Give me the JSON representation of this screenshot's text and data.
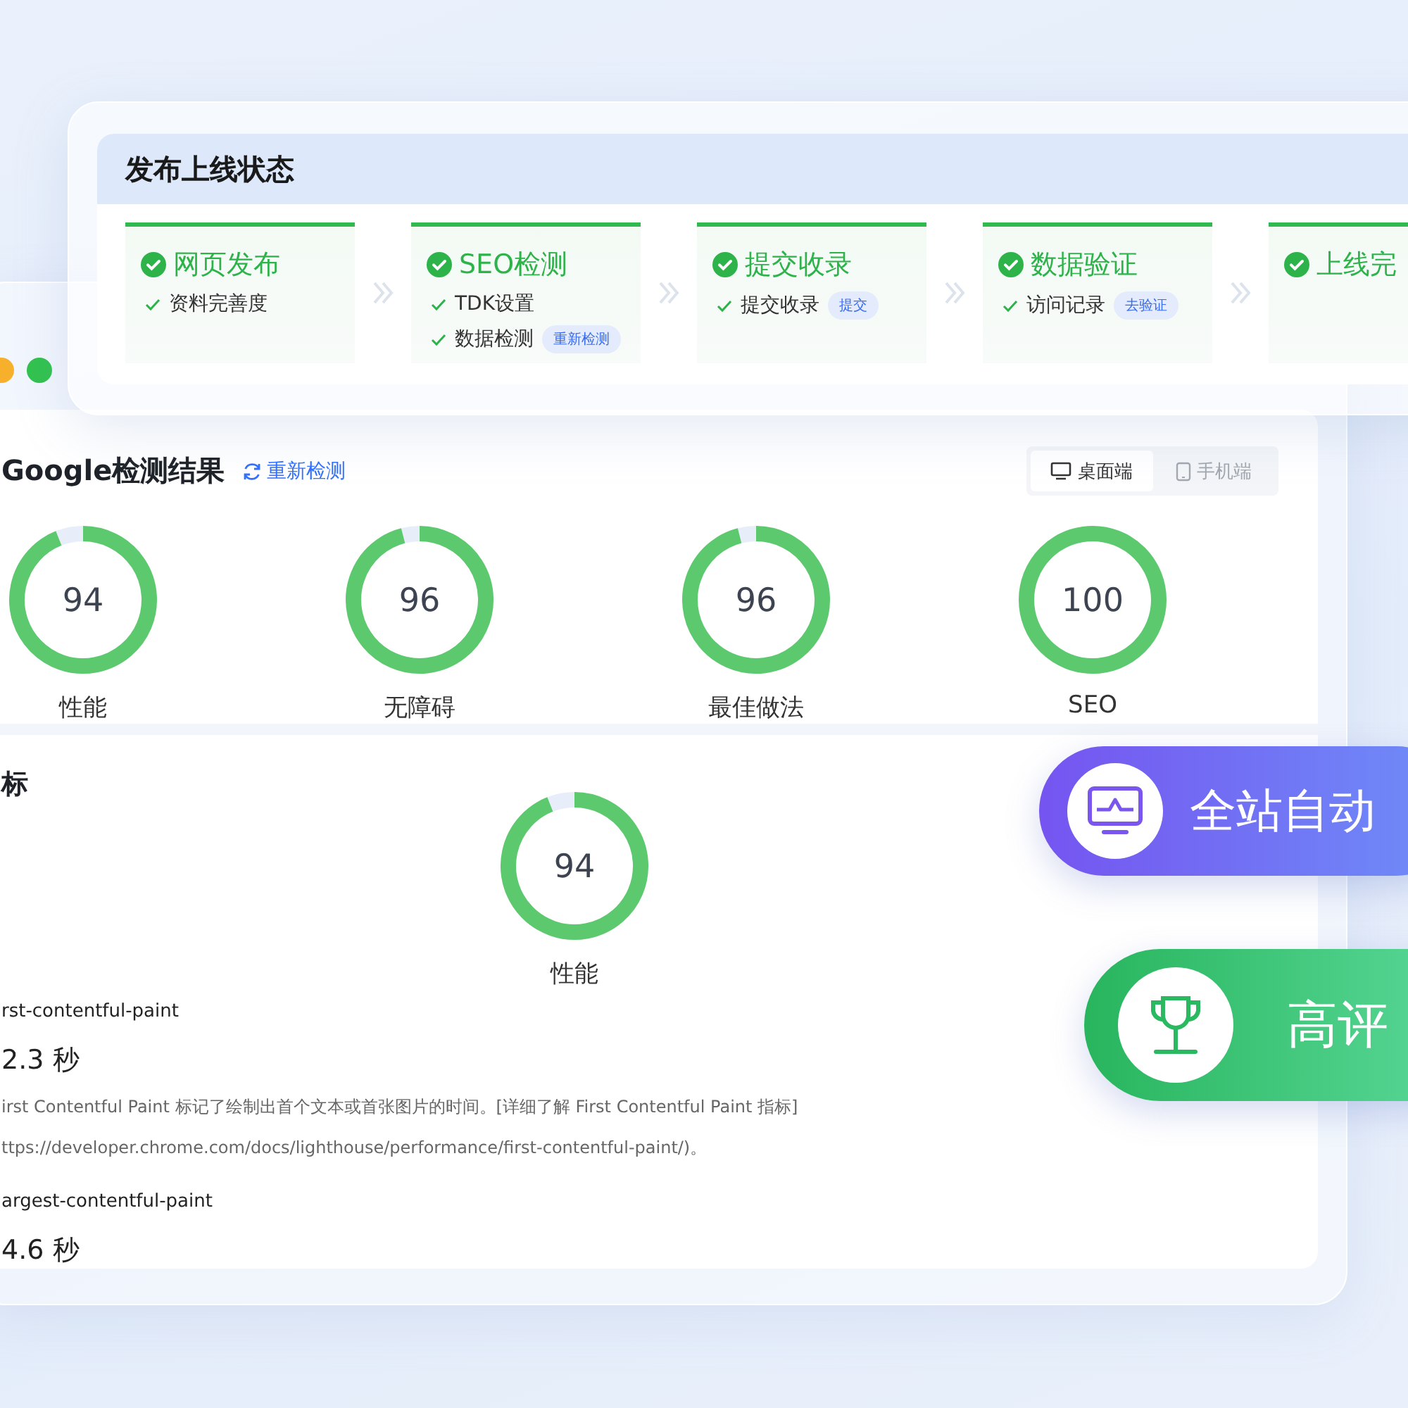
{
  "status_panel": {
    "title": "发布上线状态",
    "steps": [
      {
        "title": "网页发布",
        "done": true,
        "items": [
          {
            "label": "资料完善度"
          }
        ]
      },
      {
        "title": "SEO检测",
        "done": true,
        "items": [
          {
            "label": "TDK设置"
          },
          {
            "label": "数据检测",
            "tag": "重新检测"
          }
        ]
      },
      {
        "title": "提交收录",
        "done": true,
        "items": [
          {
            "label": "提交收录",
            "tag": "提交"
          }
        ]
      },
      {
        "title": "数据验证",
        "done": true,
        "items": [
          {
            "label": "访问记录",
            "tag": "去验证"
          }
        ]
      },
      {
        "title": "上线完",
        "done": true
      }
    ]
  },
  "results": {
    "title": "Google检测结果",
    "refresh": "重新检测",
    "view_tabs": [
      {
        "label": "桌面端",
        "kind": "desktop",
        "selected": true
      },
      {
        "label": "手机端",
        "kind": "mobile",
        "selected": false
      }
    ],
    "gauges": [
      {
        "score": "94",
        "label": "性能",
        "level": 0.94
      },
      {
        "score": "96",
        "label": "无障碍",
        "level": 0.96
      },
      {
        "score": "96",
        "label": "最佳做法",
        "level": 0.96
      },
      {
        "score": "100",
        "label": "SEO",
        "level": 1
      }
    ]
  },
  "metrics": {
    "title": "标",
    "gauge": {
      "score": "94",
      "label": "性能",
      "level": 0.94
    },
    "items": [
      {
        "name": "rst-contentful-paint",
        "value": "2.3 秒",
        "description": [
          "irst Contentful Paint 标记了绘制出首个文本或首张图片的时间。[详细了解 First Contentful Paint 指标]",
          "ttps://developer.chrome.com/docs/lighthouse/performance/first-contentful-paint/)。"
        ]
      },
      {
        "name": "argest-contentful-paint",
        "value": "4.6 秒"
      }
    ]
  },
  "badges": [
    {
      "label": "全站自动",
      "kind": "monitor"
    },
    {
      "label": "高评",
      "kind": "trophy"
    }
  ]
}
